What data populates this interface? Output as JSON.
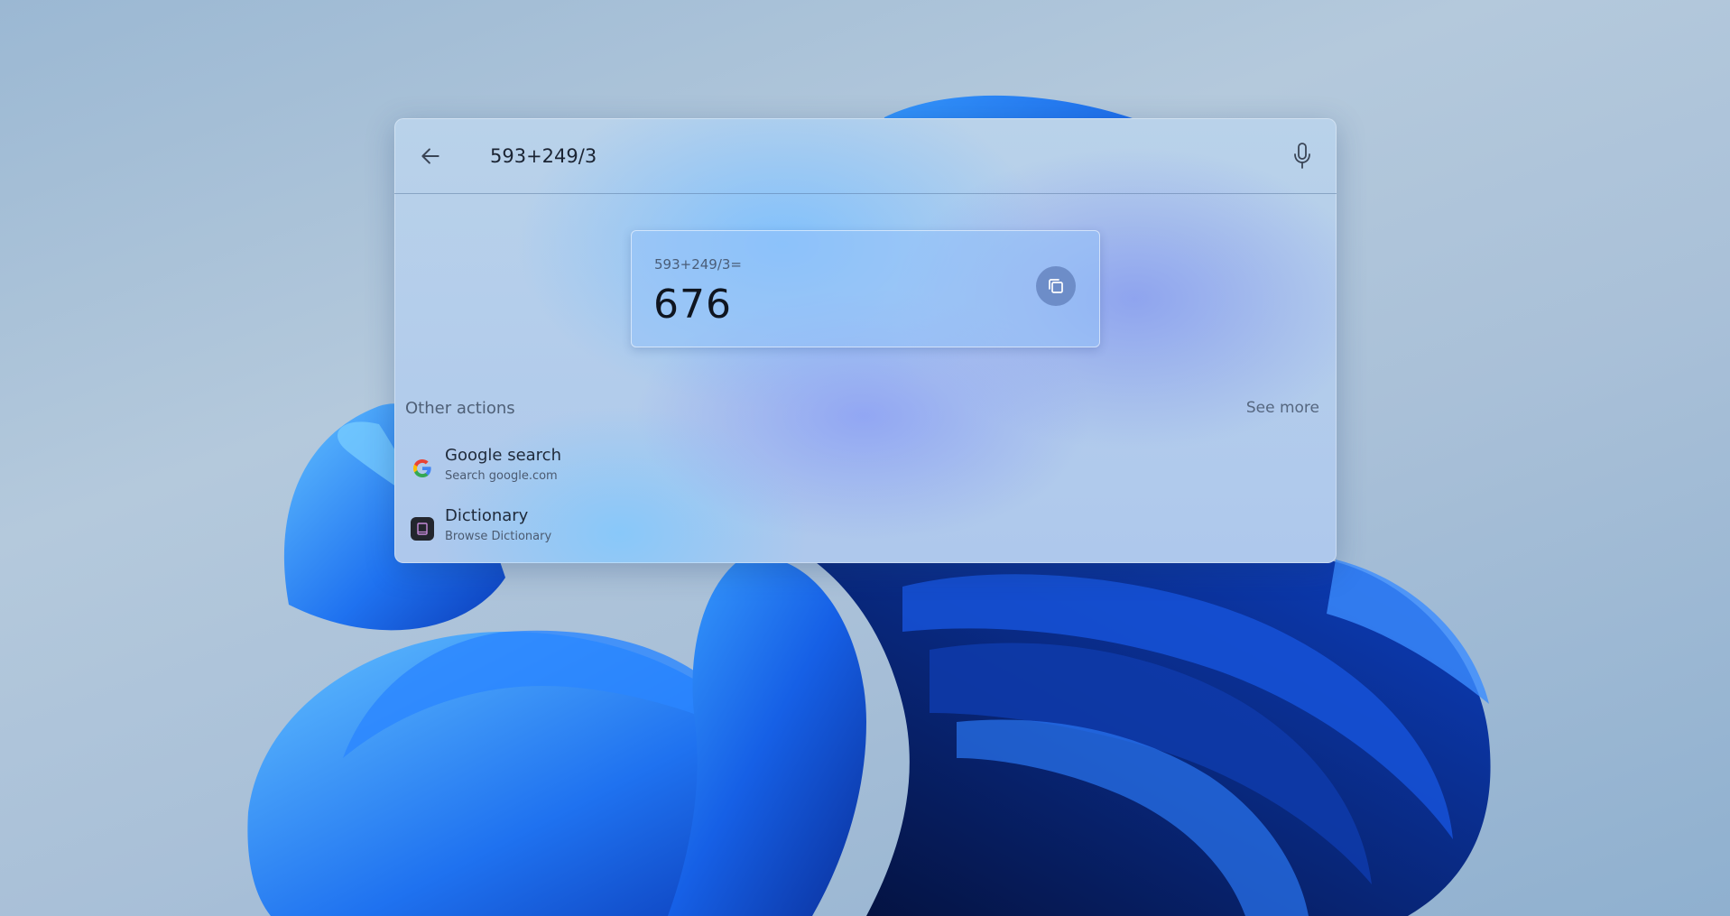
{
  "search": {
    "query": "593+249/3",
    "back_icon": "arrow-left-icon",
    "mic_icon": "microphone-icon"
  },
  "calculator": {
    "expression": "593+249/3=",
    "result": "676",
    "copy_icon": "copy-icon"
  },
  "other_actions": {
    "title": "Other actions",
    "see_more": "See more",
    "items": [
      {
        "title": "Google search",
        "subtitle": "Search google.com",
        "icon": "google-icon"
      },
      {
        "title": "Dictionary",
        "subtitle": "Browse Dictionary",
        "icon": "book-icon"
      }
    ]
  },
  "colors": {
    "wallpaper_blue": "#1d5fe0",
    "panel_tint": "#aec8ec",
    "copy_button": "#5f7db9",
    "text_primary": "#1b2433"
  }
}
